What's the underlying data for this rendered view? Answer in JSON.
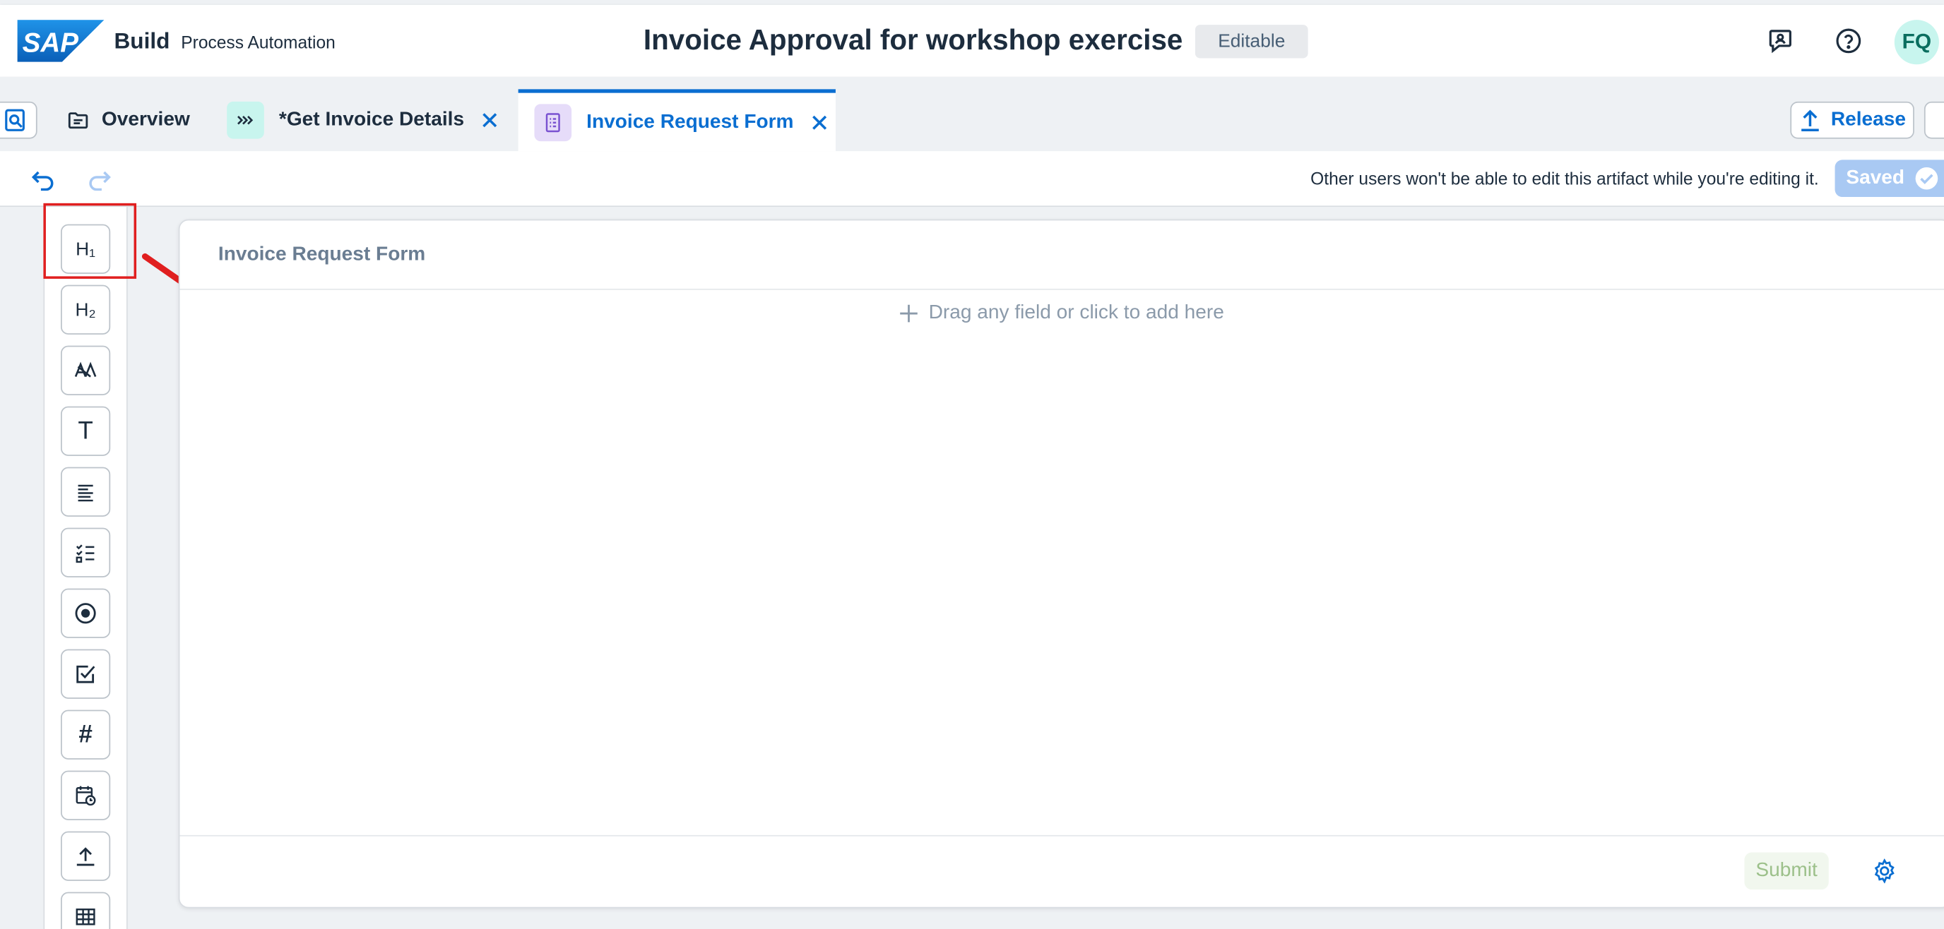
{
  "shell": {
    "logo_text": "SAP",
    "brand": "Build",
    "product": "Process Automation",
    "title": "Invoice Approval for workshop exercise",
    "status_badge": "Editable",
    "icons": [
      "feedback-icon",
      "help-icon"
    ],
    "avatar_initials": "FQ"
  },
  "tabs": {
    "items": [
      {
        "label": "Overview",
        "icon": "overview-icon",
        "closable": false,
        "active": false
      },
      {
        "label": "*Get Invoice Details",
        "icon": "automation-icon",
        "closable": true,
        "active": false
      },
      {
        "label": "Invoice Request Form",
        "icon": "form-icon",
        "closable": true,
        "active": true
      }
    ],
    "release_label": "Release"
  },
  "toolbar": {
    "lock_message": "Other users won't be able to edit this artifact while you're editing it.",
    "saved_label": "Saved"
  },
  "palette": {
    "items": [
      {
        "name": "heading1",
        "glyph": "H₁"
      },
      {
        "name": "heading2",
        "glyph": "H₂"
      },
      {
        "name": "paragraph",
        "glyph": "⨍"
      },
      {
        "name": "text-field",
        "glyph": "T"
      },
      {
        "name": "text-area",
        "glyph": "≡"
      },
      {
        "name": "checklist",
        "glyph": "☰"
      },
      {
        "name": "radio",
        "glyph": "◉"
      },
      {
        "name": "checkbox",
        "glyph": "☑"
      },
      {
        "name": "number",
        "glyph": "#"
      },
      {
        "name": "date",
        "glyph": "▦"
      },
      {
        "name": "upload",
        "glyph": "⤒"
      },
      {
        "name": "table",
        "glyph": "⊞"
      }
    ]
  },
  "canvas": {
    "form_title": "Invoice Request Form",
    "dropzone_text": "Drag any field or click to add here",
    "submit_label": "Submit"
  },
  "colors": {
    "accent": "#0a6ed1",
    "highlight": "#e01f1f",
    "avatar_bg": "#c8f5ee"
  }
}
